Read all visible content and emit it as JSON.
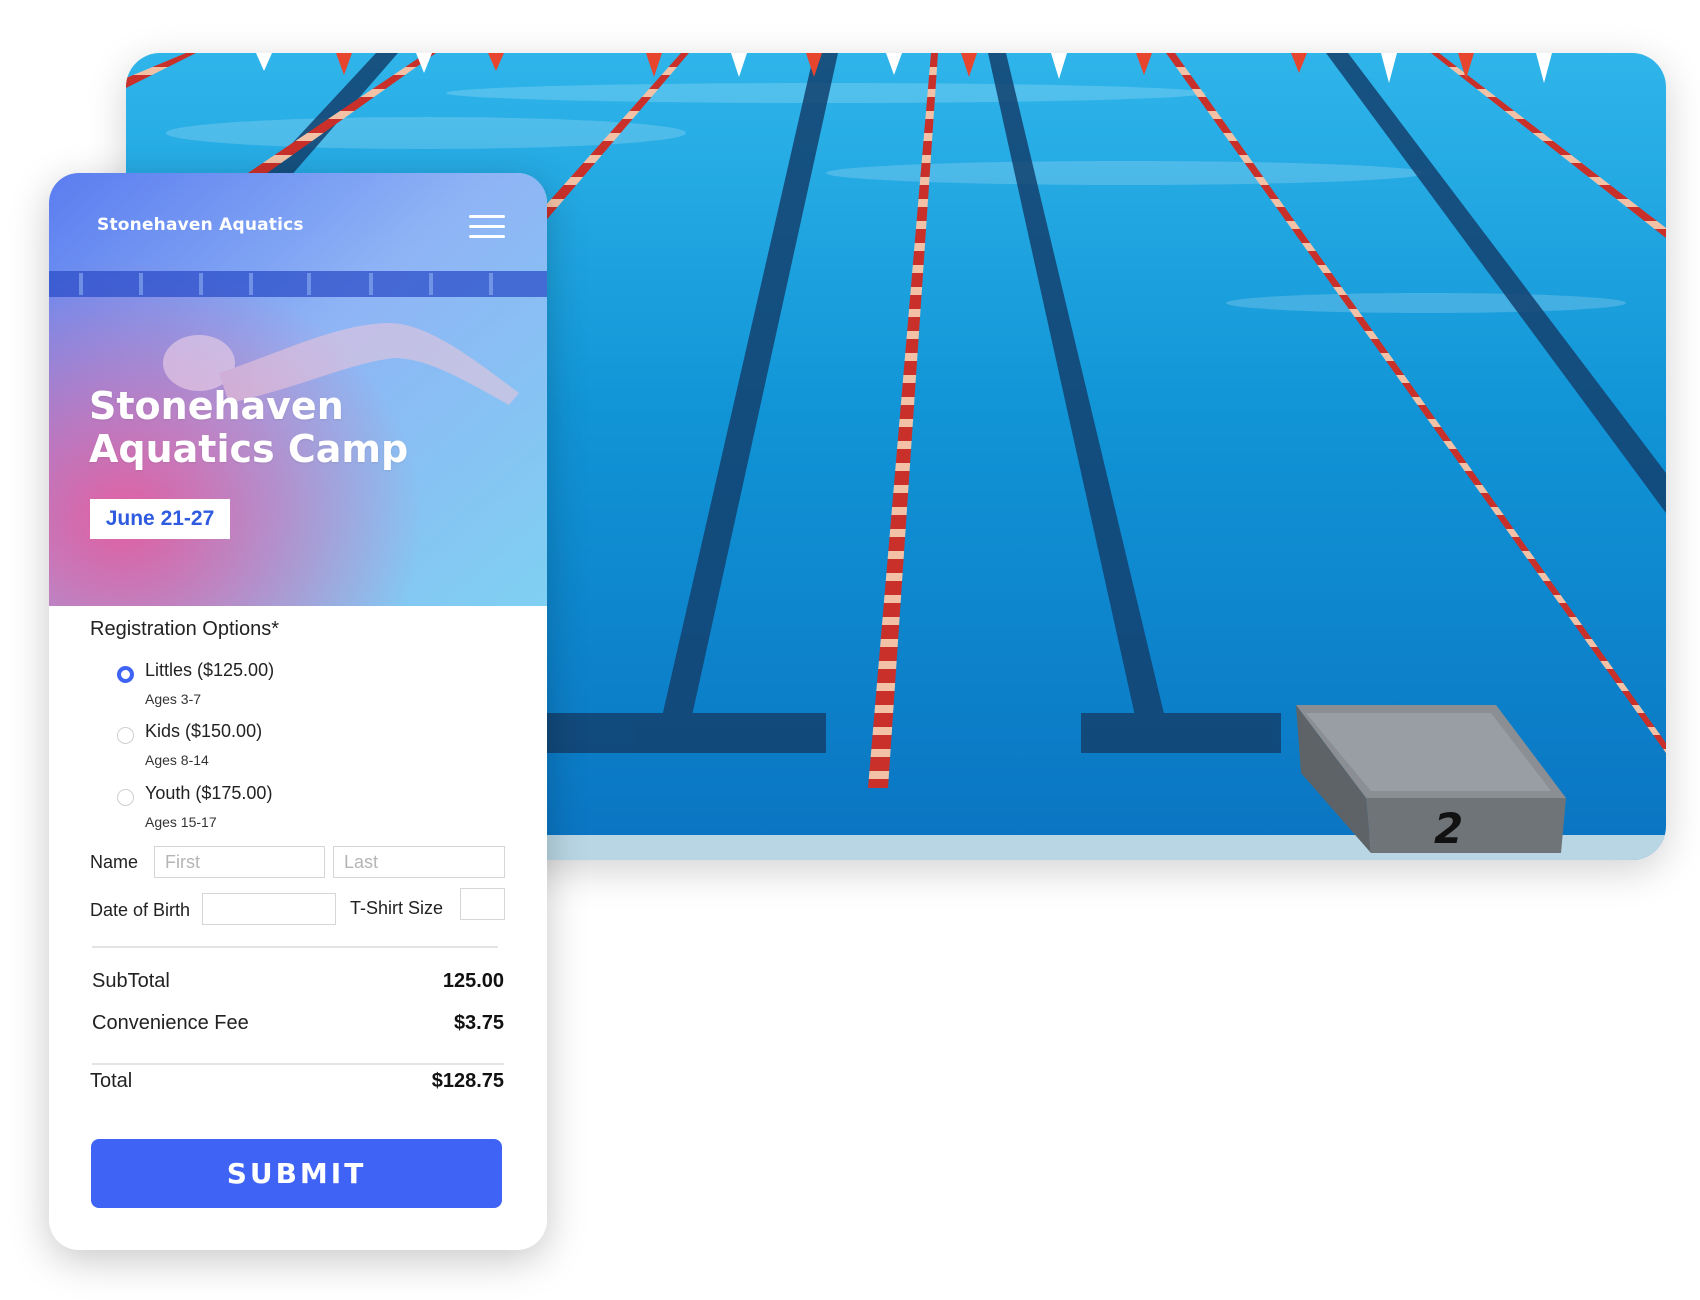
{
  "site": {
    "brand": "Stonehaven Aquatics",
    "menu_icon": "hamburger-icon"
  },
  "hero": {
    "title": "Stonehaven Aquatics Camp",
    "dates": "June 21-27"
  },
  "registration": {
    "title": "Registration Options*",
    "options": [
      {
        "label": "Littles ($125.00)",
        "ages": "Ages 3-7",
        "selected": true
      },
      {
        "label": "Kids ($150.00)",
        "ages": "Ages 8-14",
        "selected": false
      },
      {
        "label": "Youth ($175.00)",
        "ages": "Ages 15-17",
        "selected": false
      }
    ]
  },
  "fields": {
    "name_label": "Name",
    "first_placeholder": "First",
    "last_placeholder": "Last",
    "dob_label": "Date of Birth",
    "tshirt_label": "T-Shirt Size"
  },
  "summary": {
    "subtotal_label": "SubTotal",
    "subtotal_value": "125.00",
    "fee_label": "Convenience Fee",
    "fee_value": "$3.75",
    "total_label": "Total",
    "total_value": "$128.75"
  },
  "submit_label": "SUBMIT",
  "pool": {
    "block_number": "2"
  },
  "colors": {
    "accent": "#3f63f5",
    "date_text": "#2f5be0",
    "pool_water": "#0f8fd0"
  }
}
